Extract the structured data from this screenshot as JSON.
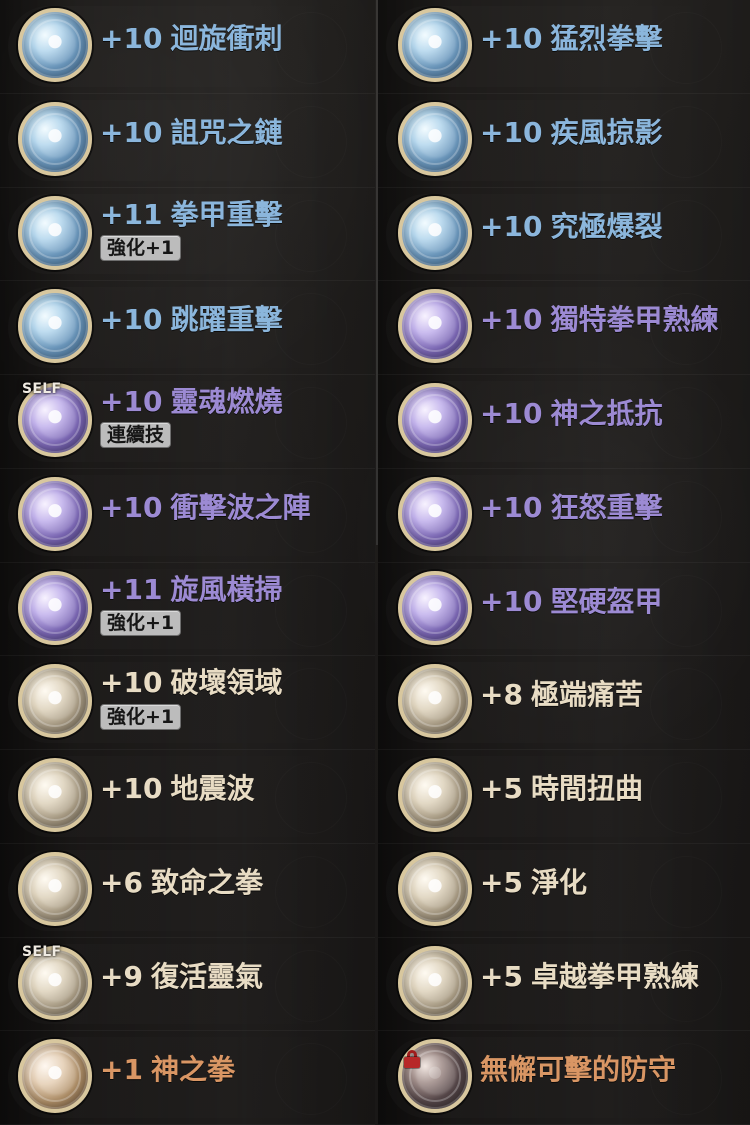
{
  "skills": {
    "left": [
      {
        "icon": "swirl-fist-icon",
        "level": "+10",
        "name": "迴旋衝刺",
        "badge": "",
        "self_tag": "",
        "color": "#8bb6dc"
      },
      {
        "icon": "chain-curse-icon",
        "level": "+10",
        "name": "詛咒之鏈",
        "badge": "",
        "self_tag": "",
        "color": "#8bb6dc"
      },
      {
        "icon": "gauntlet-strike-icon",
        "level": "+11",
        "name": "拳甲重擊",
        "badge": "強化+1",
        "self_tag": "",
        "color": "#8bb6dc"
      },
      {
        "icon": "leap-strike-icon",
        "level": "+10",
        "name": "跳躍重擊",
        "badge": "",
        "self_tag": "",
        "color": "#8bb6dc"
      },
      {
        "icon": "soul-burn-icon",
        "level": "+10",
        "name": "靈魂燃燒",
        "badge": "連續技",
        "self_tag": "SELF",
        "color": "#9c8ad3"
      },
      {
        "icon": "shockwave-formation-icon",
        "level": "+10",
        "name": "衝擊波之陣",
        "badge": "",
        "self_tag": "",
        "color": "#9c8ad3"
      },
      {
        "icon": "whirlwind-sweep-icon",
        "level": "+11",
        "name": "旋風橫掃",
        "badge": "強化+1",
        "self_tag": "",
        "color": "#9c8ad3"
      },
      {
        "icon": "destruction-domain-icon",
        "level": "+10",
        "name": "破壞領域",
        "badge": "強化+1",
        "self_tag": "",
        "color": "#e8dcc4"
      },
      {
        "icon": "earthquake-wave-icon",
        "level": "+10",
        "name": "地震波",
        "badge": "",
        "self_tag": "",
        "color": "#e8dcc4"
      },
      {
        "icon": "deadly-fist-icon",
        "level": "+6",
        "name": "致命之拳",
        "badge": "",
        "self_tag": "",
        "color": "#e8dcc4"
      },
      {
        "icon": "revival-aura-icon",
        "level": "+9",
        "name": "復活靈氣",
        "badge": "",
        "self_tag": "SELF",
        "color": "#e8dcc4"
      },
      {
        "icon": "god-fist-icon",
        "level": "+1",
        "name": "神之拳",
        "badge": "",
        "self_tag": "",
        "color": "#d99664"
      }
    ],
    "right": [
      {
        "icon": "fierce-punch-icon",
        "level": "+10",
        "name": "猛烈拳擊",
        "badge": "",
        "self_tag": "",
        "color": "#8bb6dc"
      },
      {
        "icon": "gale-shadow-icon",
        "level": "+10",
        "name": "疾風掠影",
        "badge": "",
        "self_tag": "",
        "color": "#8bb6dc"
      },
      {
        "icon": "ultimate-burst-icon",
        "level": "+10",
        "name": "究極爆裂",
        "badge": "",
        "self_tag": "",
        "color": "#8bb6dc"
      },
      {
        "icon": "unique-gauntlet-mastery-icon",
        "level": "+10",
        "name": "獨特拳甲熟練",
        "badge": "",
        "self_tag": "",
        "color": "#9c8ad3"
      },
      {
        "icon": "divine-resistance-icon",
        "level": "+10",
        "name": "神之抵抗",
        "badge": "",
        "self_tag": "",
        "color": "#9c8ad3"
      },
      {
        "icon": "rage-strike-icon",
        "level": "+10",
        "name": "狂怒重擊",
        "badge": "",
        "self_tag": "",
        "color": "#9c8ad3"
      },
      {
        "icon": "hard-armor-icon",
        "level": "+10",
        "name": "堅硬盔甲",
        "badge": "",
        "self_tag": "",
        "color": "#9c8ad3"
      },
      {
        "icon": "extreme-pain-icon",
        "level": "+8",
        "name": "極端痛苦",
        "badge": "",
        "self_tag": "",
        "color": "#e8dcc4"
      },
      {
        "icon": "time-distortion-icon",
        "level": "+5",
        "name": "時間扭曲",
        "badge": "",
        "self_tag": "",
        "color": "#e8dcc4"
      },
      {
        "icon": "purification-icon",
        "level": "+5",
        "name": "淨化",
        "badge": "",
        "self_tag": "",
        "color": "#e8dcc4"
      },
      {
        "icon": "superior-gauntlet-mastery-icon",
        "level": "+5",
        "name": "卓越拳甲熟練",
        "badge": "",
        "self_tag": "",
        "color": "#e8dcc4"
      },
      {
        "icon": "flawless-defense-lock-icon",
        "level": "",
        "name": "無懈可擊的防守",
        "badge": "",
        "self_tag": "",
        "color": "#d99664"
      }
    ]
  }
}
